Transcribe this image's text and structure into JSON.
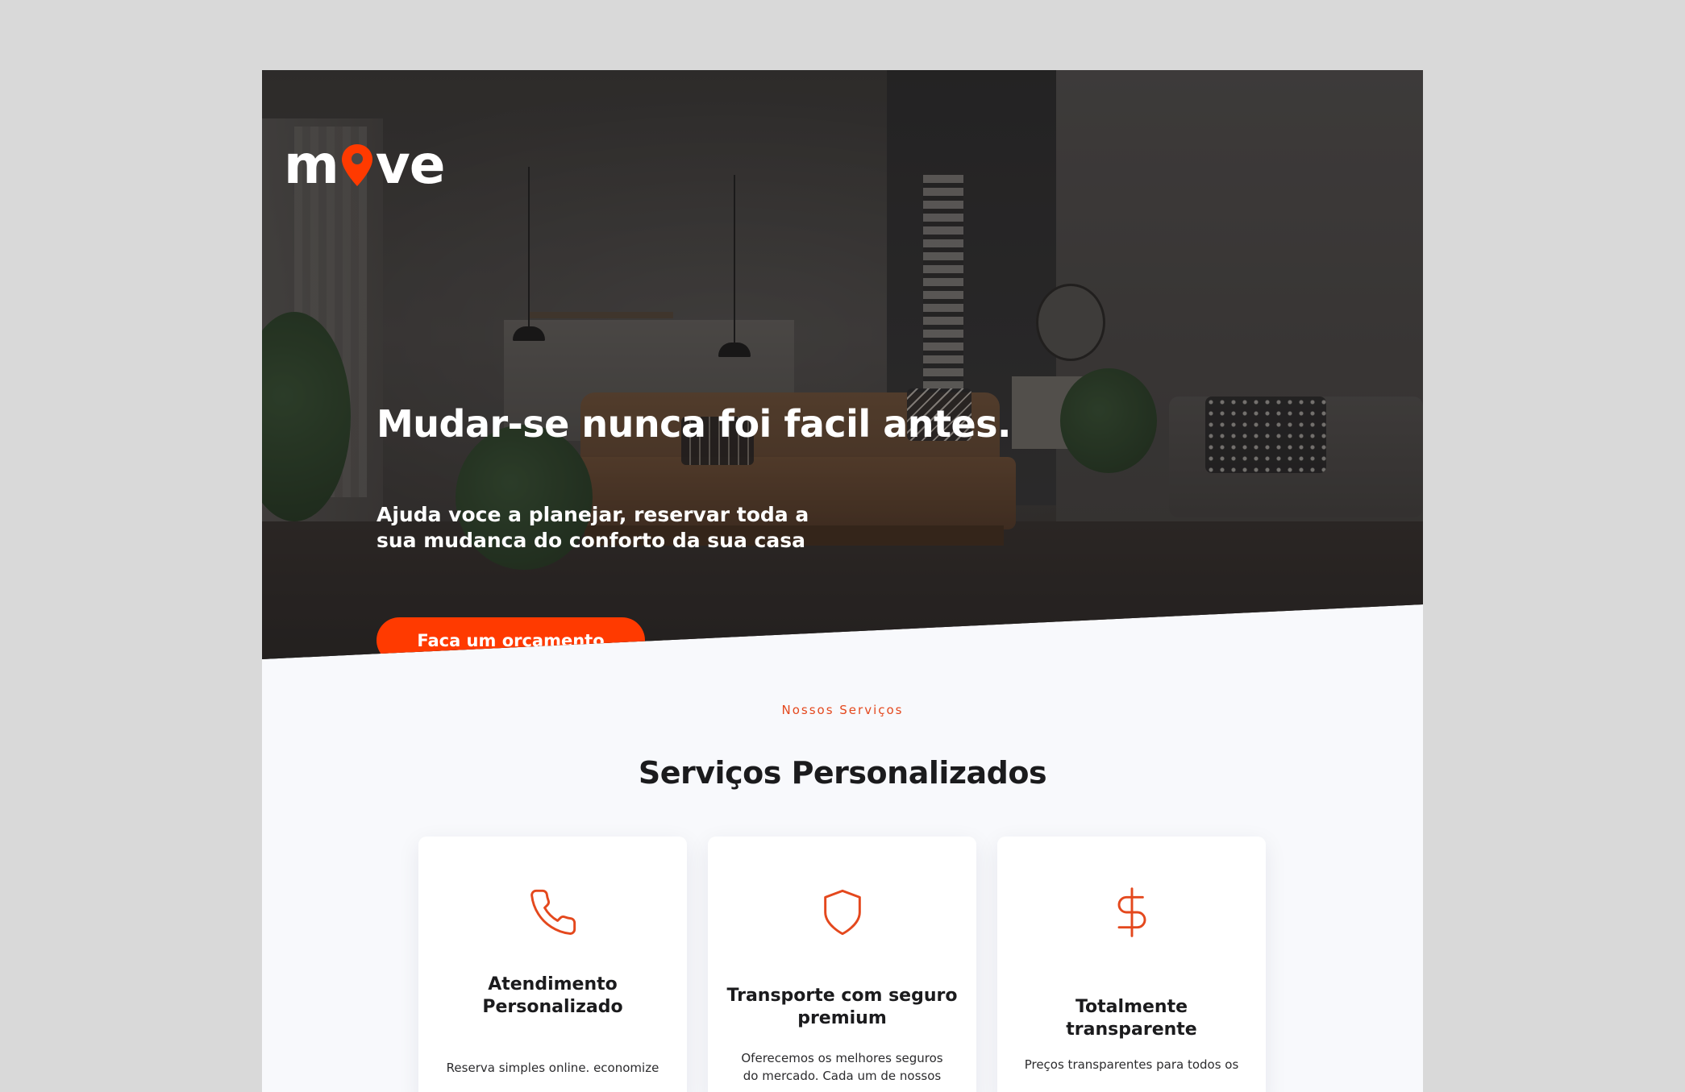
{
  "brand": {
    "logo_text_left": "m",
    "logo_text_right": "ve",
    "pin_icon": "map-pin-icon",
    "accent_color": "#ff3a00"
  },
  "hero": {
    "title": "Mudar-se nunca foi facil antes.",
    "subtitle": "Ajuda voce a planejar, reservar toda a sua mudanca do conforto da sua casa",
    "cta_label": "Faca um orcamento"
  },
  "services": {
    "eyebrow": "Nossos Serviços",
    "title": "Serviços Personalizados",
    "cards": [
      {
        "icon": "phone-icon",
        "title": "Atendimento Personalizado",
        "text": "Reserva simples online. economize"
      },
      {
        "icon": "shield-icon",
        "title": "Transporte com seguro premium",
        "text": "Oferecemos os melhores seguros do mercado. Cada um de nossos"
      },
      {
        "icon": "dollar-icon",
        "title": "Totalmente transparente",
        "text": "Preços transparentes para todos os"
      }
    ]
  }
}
